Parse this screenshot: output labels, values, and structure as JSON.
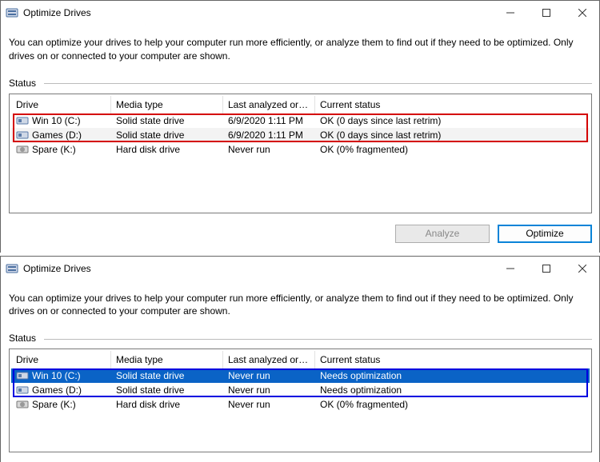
{
  "window_title": "Optimize Drives",
  "description": "You can optimize your drives to help your computer run more efficiently, or analyze them to find out if they need to be optimized. Only drives on or connected to your computer are shown.",
  "status_label": "Status",
  "columns": {
    "drive": "Drive",
    "media_type": "Media type",
    "last_analyzed": "Last analyzed or o...",
    "current_status": "Current status"
  },
  "buttons": {
    "analyze": "Analyze",
    "optimize": "Optimize"
  },
  "panel_top": {
    "rows": [
      {
        "drive": "Win 10 (C:)",
        "media": "Solid state drive",
        "last": "6/9/2020 1:11 PM",
        "status": "OK (0 days since last retrim)",
        "icon": "ssd"
      },
      {
        "drive": "Games (D:)",
        "media": "Solid state drive",
        "last": "6/9/2020 1:11 PM",
        "status": "OK (0 days since last retrim)",
        "icon": "ssd"
      },
      {
        "drive": "Spare (K:)",
        "media": "Hard disk drive",
        "last": "Never run",
        "status": "OK (0% fragmented)",
        "icon": "hdd"
      }
    ]
  },
  "panel_bottom": {
    "rows": [
      {
        "drive": "Win 10 (C:)",
        "media": "Solid state drive",
        "last": "Never run",
        "status": "Needs optimization",
        "icon": "ssd",
        "selected": true
      },
      {
        "drive": "Games (D:)",
        "media": "Solid state drive",
        "last": "Never run",
        "status": "Needs optimization",
        "icon": "ssd"
      },
      {
        "drive": "Spare (K:)",
        "media": "Hard disk drive",
        "last": "Never run",
        "status": "OK (0% fragmented)",
        "icon": "hdd"
      }
    ]
  }
}
